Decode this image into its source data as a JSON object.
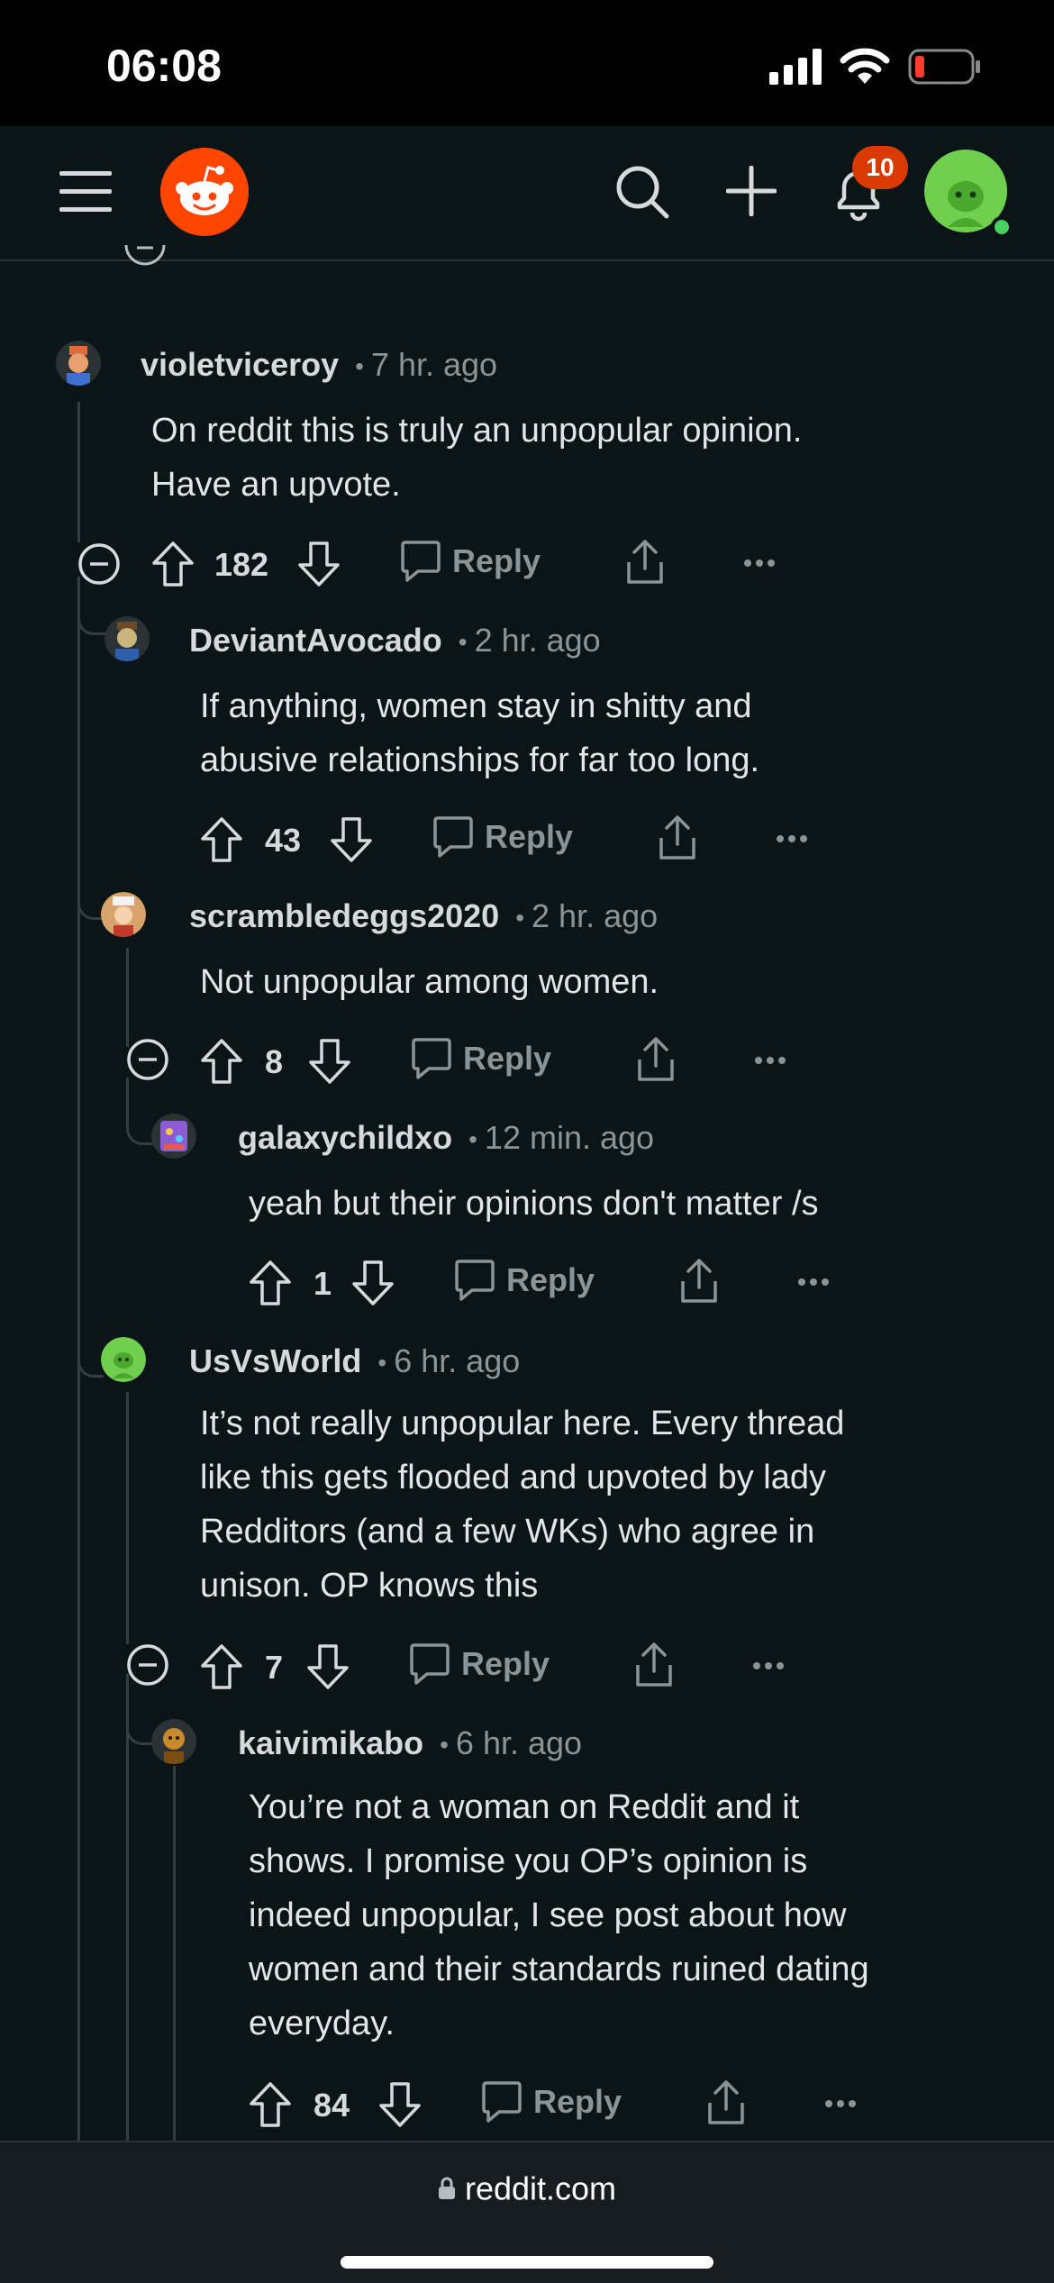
{
  "status": {
    "time": "06:08"
  },
  "nav": {
    "notification_count": "10"
  },
  "comments": [
    {
      "username": "violetviceroy",
      "time": "7 hr. ago",
      "body": [
        "On reddit this is truly an unpopular opinion.",
        "Have an upvote."
      ],
      "votes": "182",
      "reply": "Reply",
      "avatar_color": "#e06a3b"
    },
    {
      "username": "DeviantAvocado",
      "time": "2 hr. ago",
      "body": [
        "If anything, women stay in shitty and",
        "abusive relationships for far too long."
      ],
      "votes": "43",
      "reply": "Reply",
      "avatar_color": "#c9b47a"
    },
    {
      "username": "scrambledeggs2020",
      "time": "2 hr. ago",
      "body": [
        "Not unpopular among women."
      ],
      "votes": "8",
      "reply": "Reply",
      "avatar_color": "#d9a46c"
    },
    {
      "username": "galaxychildxo",
      "time": "12 min. ago",
      "body": [
        "yeah but their opinions don't matter /s"
      ],
      "votes": "1",
      "reply": "Reply",
      "avatar_color": "#8c5bd6"
    },
    {
      "username": "UsVsWorld",
      "time": "6 hr. ago",
      "body": [
        "It’s not really unpopular here. Every thread",
        "like this gets flooded and upvoted by lady",
        "Redditors (and a few WKs) who agree in",
        "unison. OP knows this"
      ],
      "votes": "7",
      "reply": "Reply",
      "avatar_color": "#6fcf4f"
    },
    {
      "username": "kaivimikabo",
      "time": "6 hr. ago",
      "body": [
        "You’re not a woman on Reddit and it",
        "shows. I promise you OP’s opinion is",
        "indeed unpopular, I see post about how",
        "women and their standards ruined dating",
        "everyday."
      ],
      "votes": "84",
      "reply": "Reply",
      "avatar_color": "#c98a2c"
    }
  ],
  "footer": {
    "url": "reddit.com"
  },
  "colors": {
    "brand": "#ff4500",
    "badge": "#d93a00",
    "background": "#0b1416",
    "avatar_green": "#6fcf4f"
  }
}
